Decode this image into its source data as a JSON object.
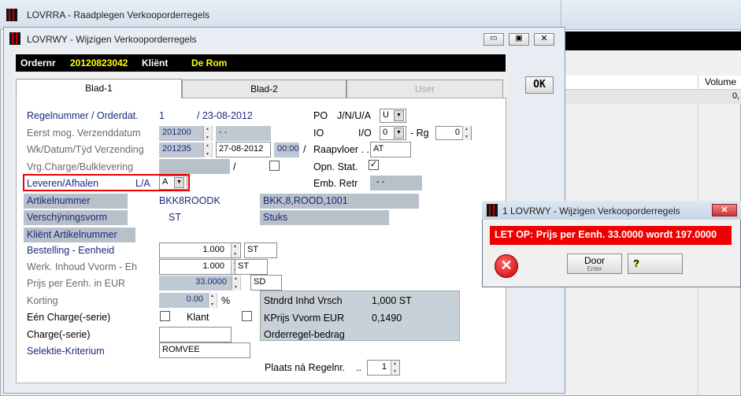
{
  "background_window": {
    "title": "LOVRRA - Raadplegen Verkooporderregels",
    "grid_header": "Volume",
    "grid_first_value": "0,"
  },
  "main_window": {
    "title": "LOVRWY - Wijzigen Verkooporderregels",
    "ok_label": "OK",
    "header": {
      "ordernr_label": "Ordernr",
      "ordernr_value": "20120823042",
      "client_label": "Kliënt",
      "client_value": "De Rom"
    },
    "tabs": [
      {
        "label": "Blad-1"
      },
      {
        "label": "Blad-2"
      },
      {
        "label": "User"
      }
    ],
    "form": {
      "regelnummer_label": "Regelnummer / Orderdat.",
      "regelnummer_value": "1",
      "orderdat_value": "/ 23-08-2012",
      "eerst_label": "Eerst mog. Verzenddatum",
      "eerst_value": "201200",
      "eerst_date": "- -",
      "wk_label": "Wk/Datum/Tÿd Verzending",
      "wk_value": "201235",
      "wk_date": "27-08-2012",
      "wk_time": "00:00",
      "wk_slash": "/",
      "vrg_label": "Vrg.Charge/Bulklevering",
      "vrg_slash": "/",
      "leveren_label": "Leveren/Afhalen",
      "leveren_code": "L/A",
      "leveren_value": "A",
      "artikel_label": "Artikelnummer",
      "artikel_value": "BKK8ROODK",
      "artikel_desc": "BKK,8,ROOD,1001",
      "verschijning_label": "Verschÿningsvorm",
      "verschijning_value": "ST",
      "verschijning_desc": "Stuks",
      "klient_art_label": "Kliënt Artikelnummer",
      "bestelling_label": "Bestelling - Eenheid",
      "bestelling_value": "1.000",
      "bestelling_unit": "ST",
      "werk_label": "Werk. Inhoud Vvorm - Eh",
      "werk_value": "1.000",
      "werk_unit": "ST",
      "prijs_label": "Prijs per Eenh. in EUR",
      "prijs_value": "33.0000",
      "prijs_unit": "SD",
      "korting_label": "Korting",
      "korting_value": "0.00",
      "korting_unit": "%",
      "een_charge_label": "Eén Charge(-serie)",
      "klant_label": "Klant",
      "charge_label": "Charge(-serie)",
      "selektie_label": "Selektie-Kriterium",
      "selektie_value": "ROMVEE",
      "po_label": "PO",
      "po_code": "J/N/U/A",
      "po_value": "U",
      "io_label": "IO",
      "io_code": "I/O",
      "io_value": "0",
      "rg_label": "- Rg",
      "rg_value": "0",
      "raapvloer_label": "Raapvloer . .",
      "raapvloer_value": "AT",
      "opn_label": "Opn. Stat.",
      "emb_label": "Emb. Retr",
      "emb_value": "- -",
      "stndrd_label": "Stndrd Inhd Vrsch",
      "stndrd_value": "1,000 ST",
      "kprijs_label": "KPrijs Vvorm  EUR",
      "kprijs_value": "0,1490",
      "orderregel_label": "Orderregel-bedrag",
      "plaats_label": "Plaats ná Regelnr.",
      "plaats_dots": "..",
      "plaats_value": "1"
    }
  },
  "dialog": {
    "title": "1 LOVRWY - Wijzigen Verkooporderregels",
    "message": "LET OP: Prijs per Eenh. 33.0000 wordt 197.0000",
    "door_label": "Door",
    "door_sub": "Enter",
    "help_glyph": "?"
  },
  "colors": {
    "warning": "#e00000",
    "header_value": "#ffff00",
    "label_blue": "#1a2a7a"
  }
}
